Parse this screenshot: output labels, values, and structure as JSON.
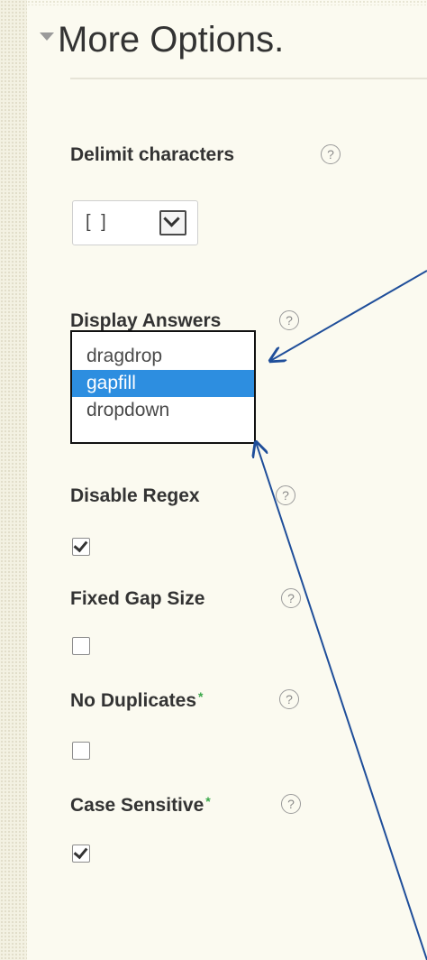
{
  "section": {
    "title": "More Options."
  },
  "fields": [
    {
      "label": "Delimit characters",
      "required": false,
      "type": "select",
      "value": "[ ]"
    },
    {
      "label": "Display Answers",
      "required": false,
      "type": "select-open",
      "options": [
        "dragdrop",
        "gapfill",
        "dropdown"
      ],
      "selected": "gapfill"
    },
    {
      "label": "Disable Regex",
      "required": false,
      "type": "checkbox",
      "checked": true
    },
    {
      "label": "Fixed Gap Size",
      "required": false,
      "type": "checkbox",
      "checked": false
    },
    {
      "label": "No Duplicates",
      "required": true,
      "type": "checkbox",
      "checked": false
    },
    {
      "label": "Case Sensitive",
      "required": true,
      "type": "checkbox",
      "checked": true
    }
  ],
  "help_glyph": "?",
  "required_mark": "*",
  "annotation_color": "#1f4e9a",
  "selection_color": "#2d8ee0"
}
